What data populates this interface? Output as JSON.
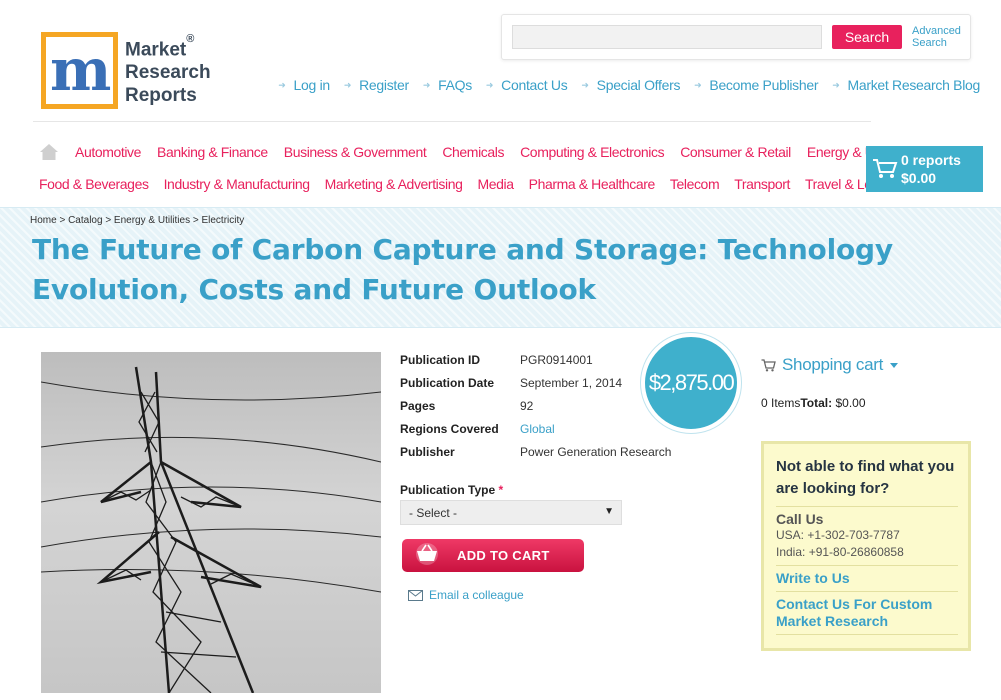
{
  "header": {
    "logo": {
      "line1": "Market",
      "line2": "Research",
      "line3": "Reports",
      "registered": "®",
      "mark": "m"
    },
    "search": {
      "placeholder": "",
      "button_label": "Search",
      "advanced_line1": "Advanced",
      "advanced_line2": "Search"
    },
    "top_links": [
      "Log in",
      "Register",
      "FAQs",
      "Contact Us",
      "Special Offers",
      "Become Publisher",
      "Market Research Blog"
    ]
  },
  "categories": {
    "row1": [
      "Automotive",
      "Banking & Finance",
      "Business & Government",
      "Chemicals",
      "Computing & Electronics",
      "Consumer & Retail",
      "Energy & Utilities"
    ],
    "row2": [
      "Food & Beverages",
      "Industry & Manufacturing",
      "Marketing & Advertising",
      "Media",
      "Pharma & Healthcare",
      "Telecom",
      "Transport",
      "Travel & Leisure"
    ]
  },
  "cart": {
    "count_label": "0 reports",
    "total_label": "$0.00"
  },
  "breadcrumb": "Home > Catalog > Energy & Utilities > Electricity",
  "page_title": "The Future of Carbon Capture and Storage: Technology Evolution, Costs and Future Outlook",
  "product": {
    "price": "$2,875.00",
    "specs": [
      {
        "label": "Publication ID",
        "value": "PGR0914001",
        "link": false
      },
      {
        "label": "Publication Date",
        "value": "September 1, 2014",
        "link": false
      },
      {
        "label": "Pages",
        "value": "92",
        "link": false
      },
      {
        "label": "Regions Covered",
        "value": "Global",
        "link": true
      },
      {
        "label": "Publisher",
        "value": "Power Generation Research",
        "link": false
      }
    ],
    "pub_type_label": "Publication Type",
    "pub_type_required": "*",
    "pub_type_selected": "- Select -",
    "add_to_cart": "ADD TO CART",
    "email_colleague": "Email a colleague"
  },
  "sidebar": {
    "shopping_cart_title": "Shopping cart",
    "items_label": "0 Items",
    "total_label": "Total:",
    "total_value": "$0.00",
    "help": {
      "title": "Not able to find what you are looking for?",
      "call_us": "Call Us",
      "usa": "USA: +1-302-703-7787",
      "india": "India: +91-80-26860858",
      "write_to_us": "Write to Us",
      "custom_research": "Contact Us For Custom Market Research"
    }
  },
  "colors": {
    "accent_blue": "#3aa0c8",
    "accent_pink": "#e8215d",
    "cart_blue": "#3fb0cc",
    "help_bg": "#fcfacd"
  }
}
